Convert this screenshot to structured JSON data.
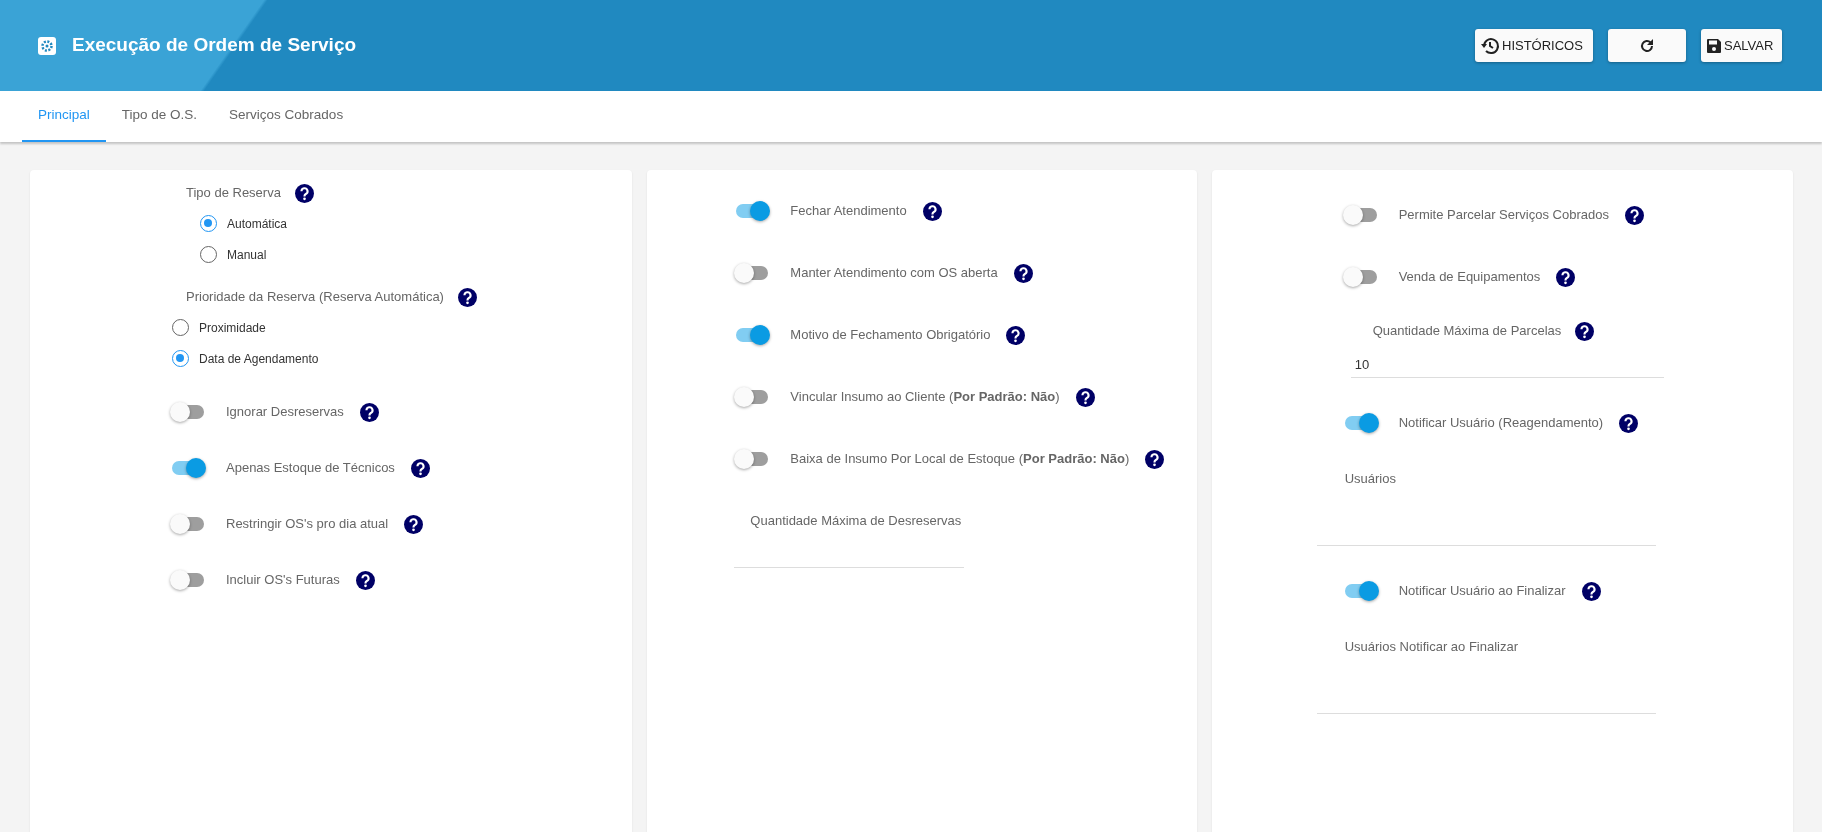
{
  "header": {
    "title": "Execução de Ordem de Serviço",
    "buttons": [
      {
        "kind": "history",
        "label": "HISTÓRICOS"
      },
      {
        "kind": "refresh"
      },
      {
        "kind": "save",
        "label": "SALVAR"
      }
    ]
  },
  "tabs": [
    {
      "label": "Principal",
      "selected": true
    },
    {
      "label": "Tipo de O.S.",
      "selected": false
    },
    {
      "label": "Serviços Cobrados",
      "selected": false
    }
  ],
  "columns": [
    {
      "items": [
        {
          "kind": "radio_group",
          "label": "Tipo de Reserva",
          "help": true,
          "options": [
            {
              "label": "Automática",
              "selected": true
            },
            {
              "label": "Manual",
              "selected": false
            }
          ]
        },
        {
          "kind": "radio_group",
          "label": "Prioridade da Reserva (Reserva Automática)",
          "help": true,
          "options": [
            {
              "label": "Proximidade",
              "selected": false
            },
            {
              "label": "Data de Agendamento",
              "selected": true
            }
          ]
        },
        {
          "kind": "toggle",
          "label": "Ignorar Desreservas",
          "on": false,
          "help": true
        },
        {
          "kind": "toggle",
          "label": "Apenas Estoque de Técnicos",
          "on": true,
          "help": true
        },
        {
          "kind": "toggle",
          "label": "Restringir OS's pro dia atual",
          "on": false,
          "help": true
        },
        {
          "kind": "toggle",
          "label": "Incluir OS's Futuras",
          "on": false,
          "help": true
        }
      ]
    },
    {
      "items": [
        {
          "kind": "toggle",
          "label": "Fechar Atendimento",
          "on": true,
          "help": true
        },
        {
          "kind": "toggle",
          "label": "Manter Atendimento com OS aberta",
          "on": false,
          "help": true
        },
        {
          "kind": "toggle",
          "label": "Motivo de Fechamento Obrigatório",
          "on": true,
          "help": true
        },
        {
          "kind": "toggle",
          "label": "Vincular Insumo ao Cliente (**Por Padrão: Não**)",
          "on": false,
          "help": true
        },
        {
          "kind": "toggle",
          "label": "Baixa de Insumo Por Local de Estoque (**Por Padrão: Não**)",
          "on": false,
          "help": true
        },
        {
          "kind": "field",
          "label": "Quantidade Máxima de Desreservas"
        }
      ]
    },
    {
      "items": [
        {
          "kind": "toggle",
          "label": "Permite Parcelar Serviços Cobrados",
          "on": false,
          "help": true
        },
        {
          "kind": "toggle",
          "label": "Venda de Equipamentos",
          "on": false,
          "help": true
        },
        {
          "kind": "field",
          "label": "Quantidade Máxima de Parcelas",
          "value": "10",
          "help": true
        },
        {
          "kind": "toggle",
          "label": "Notificar Usuário (Reagendamento)",
          "on": true,
          "help": true
        },
        {
          "kind": "field",
          "label": "Usuários"
        },
        {
          "kind": "toggle",
          "label": "Notificar Usuário ao Finalizar",
          "on": true,
          "help": true
        },
        {
          "kind": "field",
          "label": "Usuários Notificar ao Finalizar"
        }
      ]
    }
  ]
}
